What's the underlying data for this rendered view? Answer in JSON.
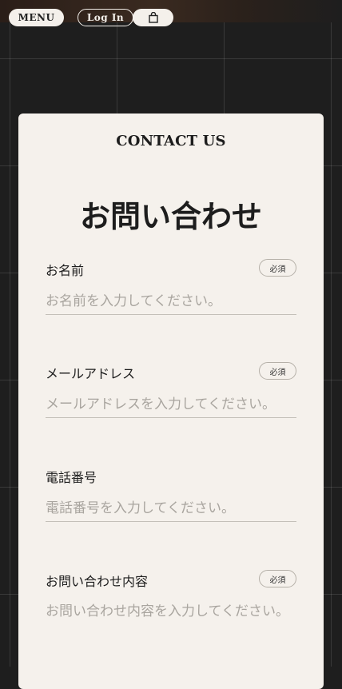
{
  "nav": {
    "menu_label": "MENU",
    "login_label": "Log In",
    "cart_icon": "shopping-bag-icon"
  },
  "contact": {
    "eyebrow": "CONTACT US",
    "title": "お問い合わせ",
    "required_label": "必須",
    "fields": [
      {
        "label": "お名前",
        "placeholder": "お名前を入力してください。",
        "required": true
      },
      {
        "label": "メールアドレス",
        "placeholder": "メールアドレスを入力してください。",
        "required": true
      },
      {
        "label": "電話番号",
        "placeholder": "電話番号を入力してください。",
        "required": false
      },
      {
        "label": "お問い合わせ内容",
        "placeholder": "お問い合わせ内容を入力してください。",
        "required": true
      }
    ]
  },
  "colors": {
    "background": "#1e1e1e",
    "card": "#f5f1ec",
    "text": "#1d1d1d",
    "placeholder": "#a9a59f"
  }
}
